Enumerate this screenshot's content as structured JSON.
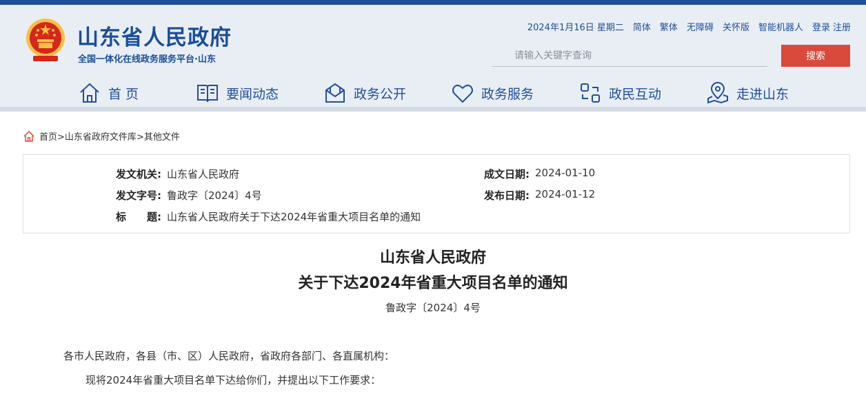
{
  "header": {
    "site_title": "山东省人民政府",
    "site_subtitle": "全国一体化在线政务服务平台·山东",
    "date": "2024年1月16日 星期二",
    "links": [
      "简体",
      "繁体",
      "无障碍",
      "关怀版",
      "智能机器人"
    ],
    "login": "登录",
    "register": "注册",
    "search_placeholder": "请输入关键字查询",
    "search_button": "搜索"
  },
  "colors": {
    "brand": "#1f4e9b",
    "search_button": "#d9493c",
    "emblem_red": "#d7261e",
    "emblem_gold": "#f5c242"
  },
  "nav": {
    "items": [
      {
        "label": "首 页",
        "icon": "home-icon"
      },
      {
        "label": "要闻动态",
        "icon": "book-icon"
      },
      {
        "label": "政务公开",
        "icon": "mail-icon"
      },
      {
        "label": "政务服务",
        "icon": "heart-icon"
      },
      {
        "label": "政民互动",
        "icon": "interaction-icon"
      },
      {
        "label": "走进山东",
        "icon": "location-icon"
      }
    ]
  },
  "breadcrumb": {
    "home": "首页",
    "level1": "山东省政府文件库",
    "level2": "其他文件",
    "sep": ">"
  },
  "meta": {
    "issuer_label": "发文机关:",
    "issuer": "山东省人民政府",
    "date_label": "成文日期:",
    "date": "2024-01-10",
    "doc_no_label": "发文字号:",
    "doc_no": "鲁政字〔2024〕4号",
    "publish_label": "发布日期:",
    "publish": "2024-01-12",
    "title_label": "标　　题:",
    "title": "山东省人民政府关于下达2024年省重大项目名单的通知"
  },
  "document": {
    "title_line1": "山东省人民政府",
    "title_line2": "关于下达2024年省重大项目名单的通知",
    "doc_no": "鲁政字〔2024〕4号",
    "salutation": "各市人民政府，各县（市、区）人民政府，省政府各部门、各直属机构：",
    "para1": "现将2024年省重大项目名单下达给你们，并提出以下工作要求："
  }
}
